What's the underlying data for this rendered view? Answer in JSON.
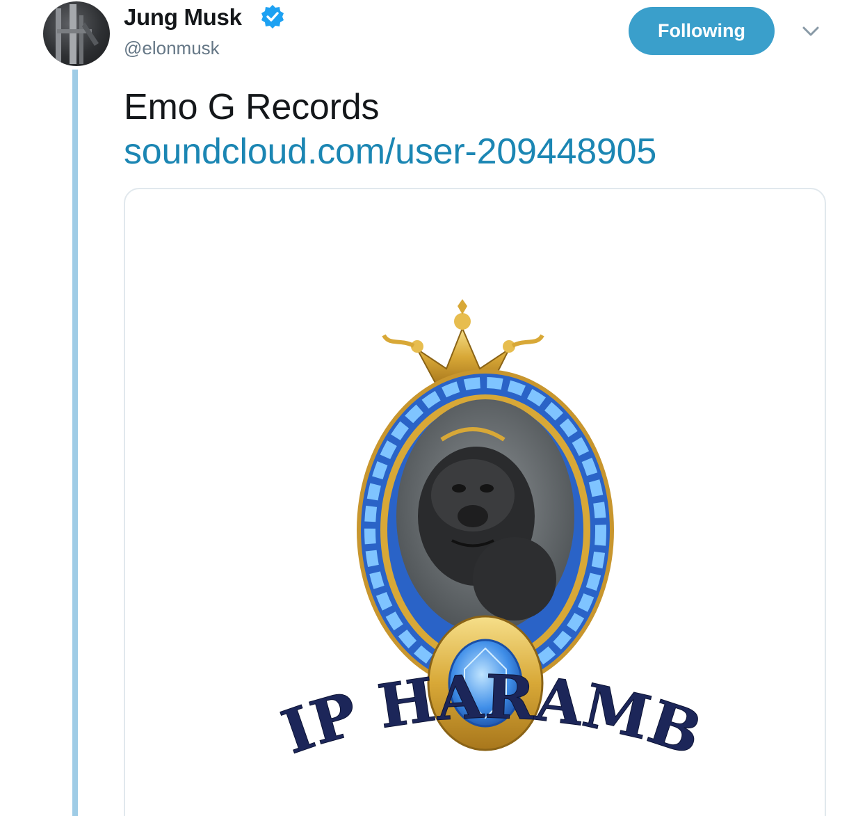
{
  "tweet": {
    "display_name": "Jung Musk",
    "handle": "@elonmusk",
    "follow_label": "Following",
    "text": "Emo G Records",
    "link": "soundcloud.com/user-209448905"
  },
  "media": {
    "logo_text": "RIP HARAMBE"
  },
  "colors": {
    "follow_button": "#3a9fcb",
    "link": "#1b86b3",
    "thread_line": "#9fcce6",
    "verified_badge": "#1da1f2",
    "logo_text": "#1c2659"
  },
  "icons": {
    "verified": "verified-badge-icon",
    "menu": "chevron-down-icon"
  }
}
